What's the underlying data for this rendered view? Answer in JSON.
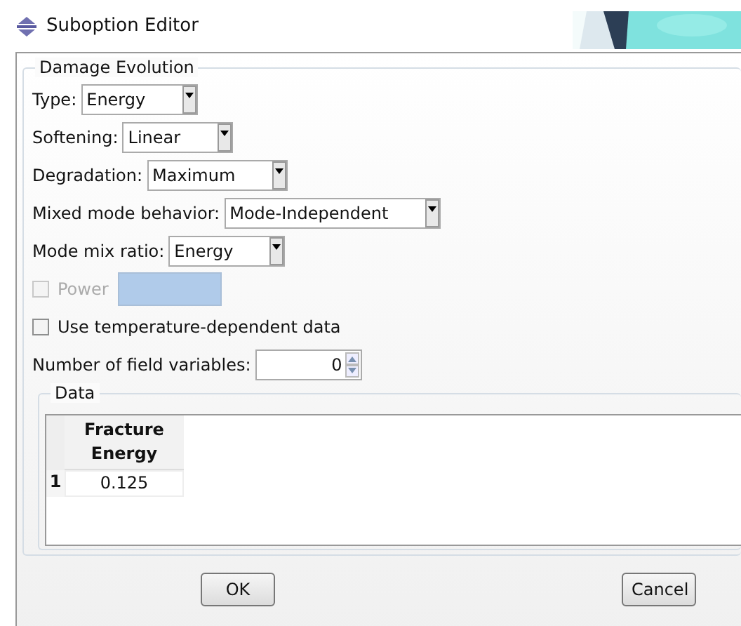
{
  "window": {
    "title": "Suboption Editor"
  },
  "group": {
    "title": "Damage Evolution"
  },
  "fields": [
    {
      "kind": "combo",
      "label": "Type:",
      "value": "Energy"
    },
    {
      "kind": "combo",
      "label": "Softening:",
      "value": "Linear"
    },
    {
      "kind": "combo",
      "label": "Degradation:",
      "value": "Maximum"
    },
    {
      "kind": "combo",
      "label": "Mixed mode behavior:",
      "value": "Mode-Independent"
    },
    {
      "kind": "combo",
      "label": "Mode mix ratio:",
      "value": "Energy"
    },
    {
      "kind": "check_input",
      "label": "Power",
      "checked": false,
      "disabled": true
    },
    {
      "kind": "check",
      "label": "Use temperature-dependent data",
      "checked": false,
      "disabled": false
    },
    {
      "kind": "spin",
      "label": "Number of field variables:",
      "value": "0"
    }
  ],
  "data": {
    "title": "Data",
    "columns": [
      "Fracture Energy"
    ],
    "rows": [
      {
        "index": "1",
        "cells": [
          "0.125"
        ]
      }
    ]
  },
  "buttons": [
    "OK",
    "Cancel"
  ]
}
